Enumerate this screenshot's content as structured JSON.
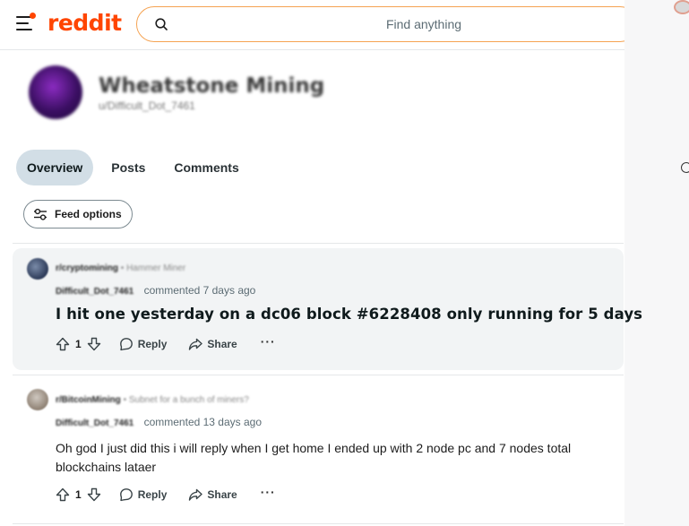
{
  "header": {
    "logo_text": "reddit",
    "search_placeholder": "Find anything",
    "brand_color": "#ff4500"
  },
  "profile": {
    "display_name": "Wheatstone Mining",
    "username": "u/Difficult_Dot_7461"
  },
  "tabs": [
    {
      "label": "Overview",
      "active": true
    },
    {
      "label": "Posts",
      "active": false
    },
    {
      "label": "Comments",
      "active": false
    }
  ],
  "feed_options_label": "Feed options",
  "comments": [
    {
      "subreddit": "r/cryptomining",
      "post_title": "Hammer Miner",
      "author": "Difficult_Dot_7461",
      "time": "commented 7 days ago",
      "body": "I hit one yesterday on a dc06 block #6228408 only running for 5 days",
      "votes": "1",
      "reply_label": "Reply",
      "share_label": "Share",
      "more_label": "···"
    },
    {
      "subreddit": "r/BitcoinMining",
      "post_title": "Subnet for a bunch of miners?",
      "author": "Difficult_Dot_7461",
      "time": "commented 13 days ago",
      "body": "Oh god I just did this i will reply when I get home I ended up with 2 node pc and 7 nodes total blockchains lataer",
      "votes": "1",
      "reply_label": "Reply",
      "share_label": "Share",
      "more_label": "···"
    }
  ],
  "icons": {
    "menu": "hamburger-icon",
    "search": "search-icon",
    "feed": "sliders-icon",
    "upvote": "upvote-icon",
    "downvote": "downvote-icon",
    "reply": "comment-bubble-icon",
    "share": "share-arrow-icon"
  }
}
